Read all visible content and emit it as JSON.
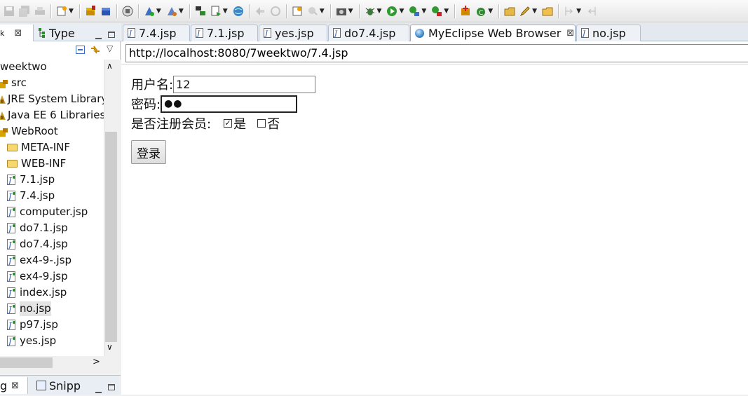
{
  "left_panel": {
    "tabs": [
      {
        "label": "",
        "close": "⊠"
      },
      {
        "label": "Type"
      }
    ],
    "bottom_tabs": [
      {
        "label": "g",
        "close": "⊠"
      },
      {
        "label": "Snipp"
      }
    ],
    "tree": [
      {
        "label": "weektwo",
        "kind": "project",
        "indent": 0
      },
      {
        "label": "src",
        "kind": "package",
        "indent": 0
      },
      {
        "label": "JRE System Library",
        "kind": "library",
        "indent": 0
      },
      {
        "label": "Java EE 6 Libraries",
        "kind": "library",
        "indent": 0
      },
      {
        "label": "WebRoot",
        "kind": "package",
        "indent": 0
      },
      {
        "label": "META-INF",
        "kind": "folder",
        "indent": 1
      },
      {
        "label": "WEB-INF",
        "kind": "folder",
        "indent": 1
      },
      {
        "label": "7.1.jsp",
        "kind": "jsp",
        "indent": 1
      },
      {
        "label": "7.4.jsp",
        "kind": "jsp",
        "indent": 1
      },
      {
        "label": "computer.jsp",
        "kind": "jsp",
        "indent": 1
      },
      {
        "label": "do7.1.jsp",
        "kind": "jsp",
        "indent": 1
      },
      {
        "label": "do7.4.jsp",
        "kind": "jsp",
        "indent": 1
      },
      {
        "label": "ex4-9-.jsp",
        "kind": "jsp",
        "indent": 1
      },
      {
        "label": "ex4-9.jsp",
        "kind": "jsp",
        "indent": 1
      },
      {
        "label": "index.jsp",
        "kind": "jsp",
        "indent": 1
      },
      {
        "label": "no.jsp",
        "kind": "jsp",
        "indent": 1,
        "selected": true
      },
      {
        "label": "p97.jsp",
        "kind": "jsp",
        "indent": 1
      },
      {
        "label": "yes.jsp",
        "kind": "jsp",
        "indent": 1
      }
    ]
  },
  "editor_tabs": [
    {
      "label": "7.4.jsp",
      "icon": "jsp-file-icon"
    },
    {
      "label": "7.1.jsp",
      "icon": "jsp-file-icon"
    },
    {
      "label": "yes.jsp",
      "icon": "jsp-file-icon"
    },
    {
      "label": "do7.4.jsp",
      "icon": "jsp-file-icon"
    },
    {
      "label": "MyEclipse Web Browser",
      "icon": "globe-icon",
      "active": true,
      "close": "⊠"
    },
    {
      "label": "no.jsp",
      "icon": "jsp-file-icon"
    }
  ],
  "browser": {
    "url": "http://localhost:8080/7weektwo/7.4.jsp",
    "form": {
      "username_label": "用户名:",
      "username_value": "12",
      "password_label": "密码:",
      "password_value": "●●",
      "member_label": "是否注册会员:",
      "yes_label": "是",
      "yes_checked": "✓",
      "no_label": "否",
      "submit_label": "登录"
    }
  },
  "colors": {
    "accent": "#3c86c8",
    "tab_border": "#99a8bd"
  }
}
